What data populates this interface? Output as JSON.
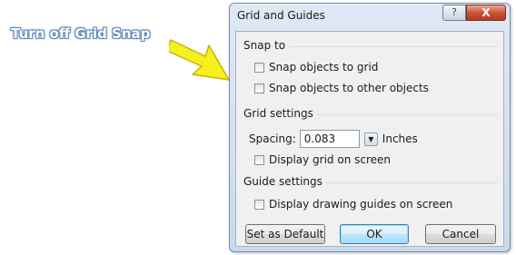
{
  "annotation": {
    "callout_text": "Turn off Grid Snap",
    "arrow_color": "#f5f01e"
  },
  "dialog": {
    "title": "Grid and Guides",
    "help_glyph": "?",
    "close_glyph": "X",
    "snap_to": {
      "label": "Snap to",
      "options": [
        {
          "label": "Snap objects to grid",
          "checked": false
        },
        {
          "label": "Snap objects to other objects",
          "checked": false
        }
      ]
    },
    "grid_settings": {
      "label": "Grid settings",
      "spacing_label": "Spacing:",
      "spacing_value": "0.083",
      "spacing_units": "Inches",
      "display_grid": {
        "label": "Display grid on screen",
        "checked": false
      }
    },
    "guide_settings": {
      "label": "Guide settings",
      "display_guides": {
        "label": "Display drawing guides on screen",
        "checked": false
      }
    },
    "buttons": {
      "set_default": "Set as Default",
      "ok": "OK",
      "cancel": "Cancel"
    }
  },
  "colors": {
    "title_bar": "#d3e1f1",
    "client_area": "#f0f0f0",
    "close_button": "#c75034",
    "callout_outline": "#5a86b8"
  }
}
